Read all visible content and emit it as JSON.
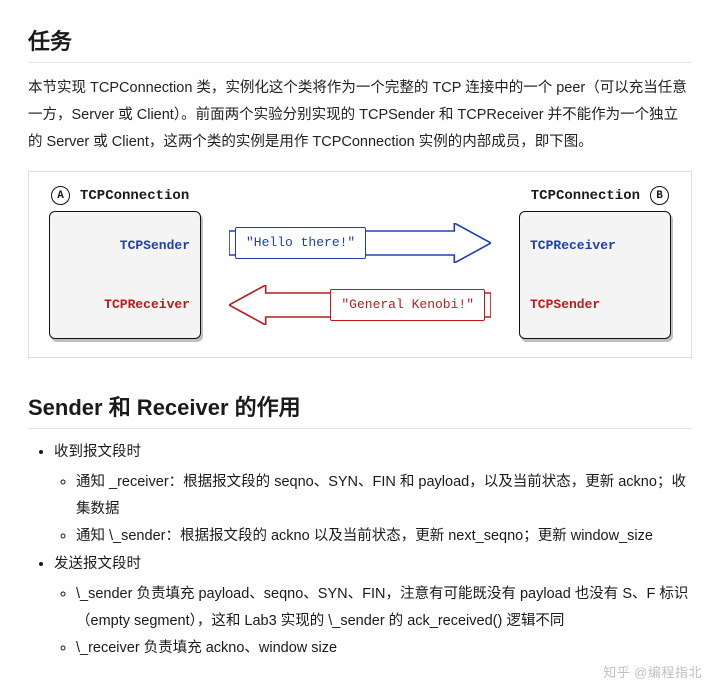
{
  "h1": "任务",
  "intro": "本节实现 TCPConnection 类，实例化这个类将作为一个完整的 TCP 连接中的一个 peer（可以充当任意一方，Server 或 Client）。前面两个实验分别实现的 TCPSender 和 TCPReceiver 并不能作为一个独立的 Server 或 Client，这两个类的实例是用作 TCPConnection 实例的内部成员，即下图。",
  "diagram": {
    "labelA": "A",
    "labelB": "B",
    "title": "TCPConnection",
    "sender": "TCPSender",
    "receiver": "TCPReceiver",
    "msg1": "\"Hello there!\"",
    "msg2": "\"General Kenobi!\""
  },
  "h2": "Sender 和 Receiver 的作用",
  "list": {
    "a": "收到报文段时",
    "a1": "通知 _receiver：根据报文段的 seqno、SYN、FIN 和 payload，以及当前状态，更新 ackno；收集数据",
    "a2": "通知 \\_sender：根据报文段的 ackno 以及当前状态，更新 next_seqno；更新 window_size",
    "b": "发送报文段时",
    "b1": "\\_sender 负责填充 payload、seqno、SYN、FIN，注意有可能既没有 payload 也没有 S、F 标识（empty segment），这和 Lab3 实现的 \\_sender 的 ack_received() 逻辑不同",
    "b2": "\\_receiver 负责填充 ackno、window size"
  },
  "watermark": "知乎 @编程指北"
}
